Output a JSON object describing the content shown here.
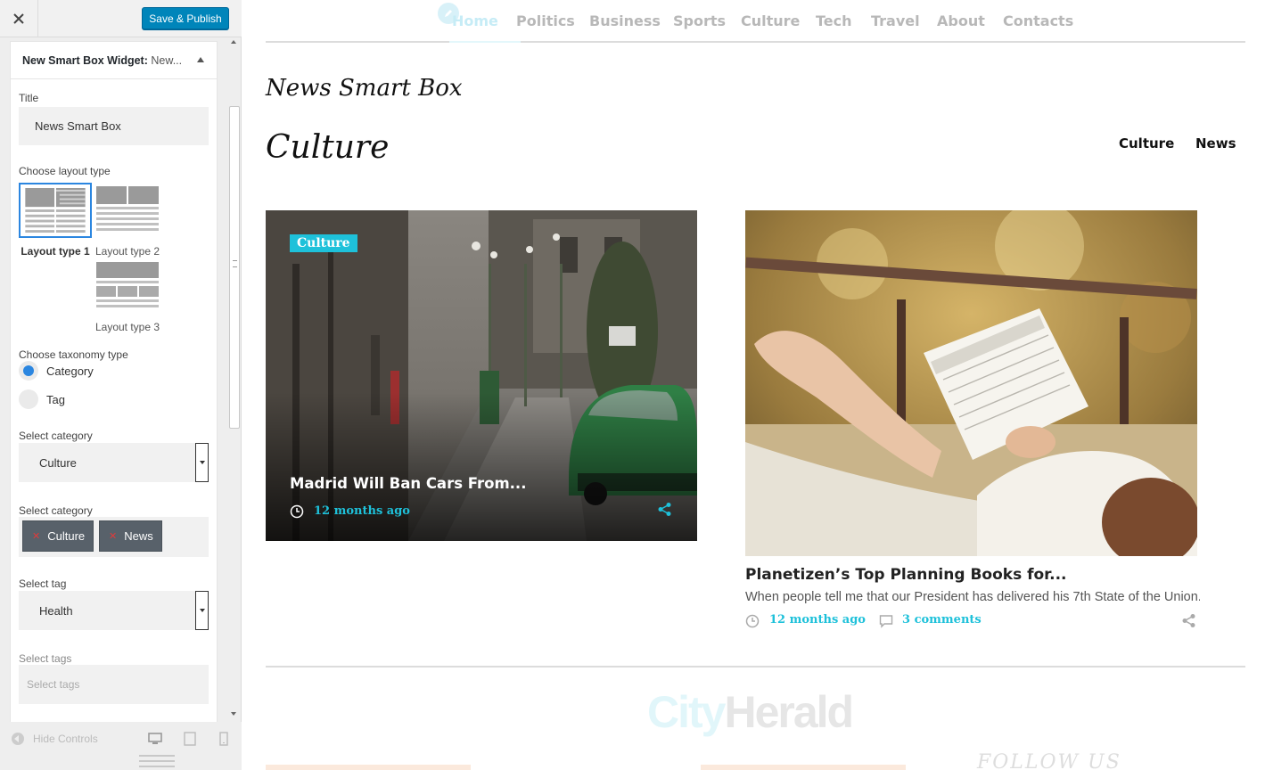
{
  "sidebar": {
    "close_icon": "close-icon",
    "save_label": "Save & Publish",
    "widget_title": "New Smart Box Widget:",
    "widget_title_sub": "New...",
    "title_label": "Title",
    "title_value": "News Smart Box",
    "layout_label": "Choose layout type",
    "layouts": [
      "Layout type 1",
      "Layout type 2",
      "Layout type 3"
    ],
    "selected_layout": "Layout type 1",
    "taxonomy_label": "Choose taxonomy type",
    "taxonomy_options": [
      "Category",
      "Tag"
    ],
    "taxonomy_selected": "Category",
    "category_select_label": "Select category",
    "category_select_value": "Culture",
    "categories_label": "Select category",
    "categories_chips": [
      "Culture",
      "News"
    ],
    "tag_select_label": "Select tag",
    "tag_select_value": "Health",
    "tags_label": "Select tags",
    "tags_placeholder": "Select tags",
    "hide_controls": "Hide Controls",
    "device_icons": [
      "desktop-icon",
      "tablet-icon",
      "mobile-icon"
    ]
  },
  "preview": {
    "nav": [
      "Home",
      "Politics",
      "Business",
      "Sports",
      "Culture",
      "Tech",
      "Travel",
      "About",
      "Contacts"
    ],
    "nav_active": "Home",
    "widget_heading": "News Smart Box",
    "section_title": "Culture",
    "filter_tabs": [
      "Culture",
      "News"
    ],
    "card1": {
      "badge": "Culture",
      "title": "Madrid Will Ban Cars From...",
      "time": "12 months ago"
    },
    "card2": {
      "title": "Planetizen’s Top Planning Books for...",
      "excerpt": "When people tell me that our President has delivered his 7th State of the Union...",
      "time": "12 months ago",
      "comments": "3 comments"
    },
    "footer_logo_a": "City",
    "footer_logo_b": "Herald",
    "follow_us": "FOLLOW US"
  },
  "colors": {
    "accent": "#1ec1da",
    "primary_button": "#0085ba",
    "radio_on": "#2b86e0",
    "chip": "#58616a"
  }
}
